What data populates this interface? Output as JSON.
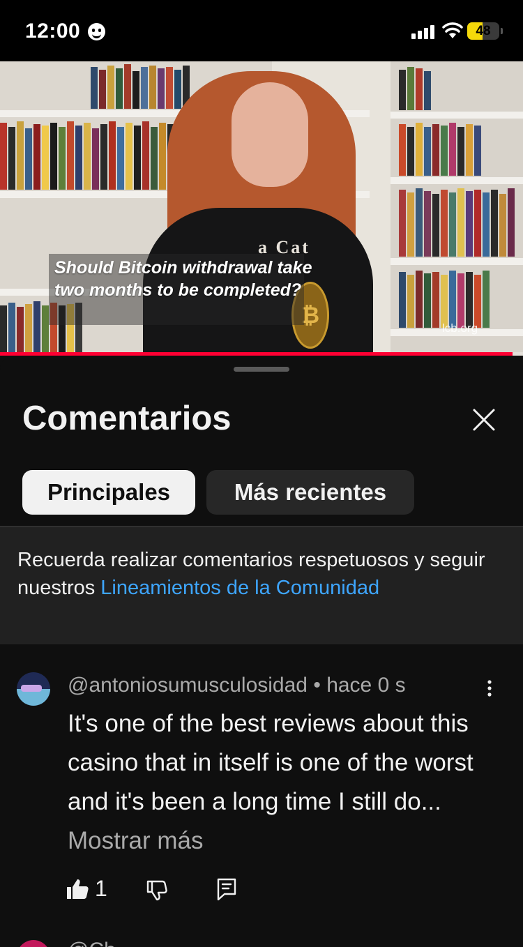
{
  "status_bar": {
    "time": "12:00",
    "battery": "48",
    "battery_level": 0.48
  },
  "video": {
    "caption": "Should Bitcoin withdrawal take two months to be completed?",
    "shirt_text": "a Cat",
    "watermark": "lcb.org",
    "progress": 0.98,
    "accent_color": "#ff0033"
  },
  "sheet": {
    "title": "Comentarios",
    "close_icon": "close-icon",
    "filters": {
      "top": "Principales",
      "newest": "Más recientes"
    },
    "notice": {
      "text": "Recuerda realizar comentarios respetuosos y seguir nuestros ",
      "link": "Lineamientos de la Comunidad"
    }
  },
  "comments": [
    {
      "handle": "@antoniosumusculosidad",
      "time": "hace 0 s",
      "text": "It's one of the best reviews about this casino that in itself is one of the worst and it's been a long time I still do...",
      "show_more": "Mostrar más",
      "likes": "1"
    }
  ],
  "next_comment": {
    "handle_partial": "@Ch"
  },
  "colors": {
    "background": "#0f0f0f",
    "link": "#3ea6ff",
    "secondary_text": "#aaaaaa"
  }
}
